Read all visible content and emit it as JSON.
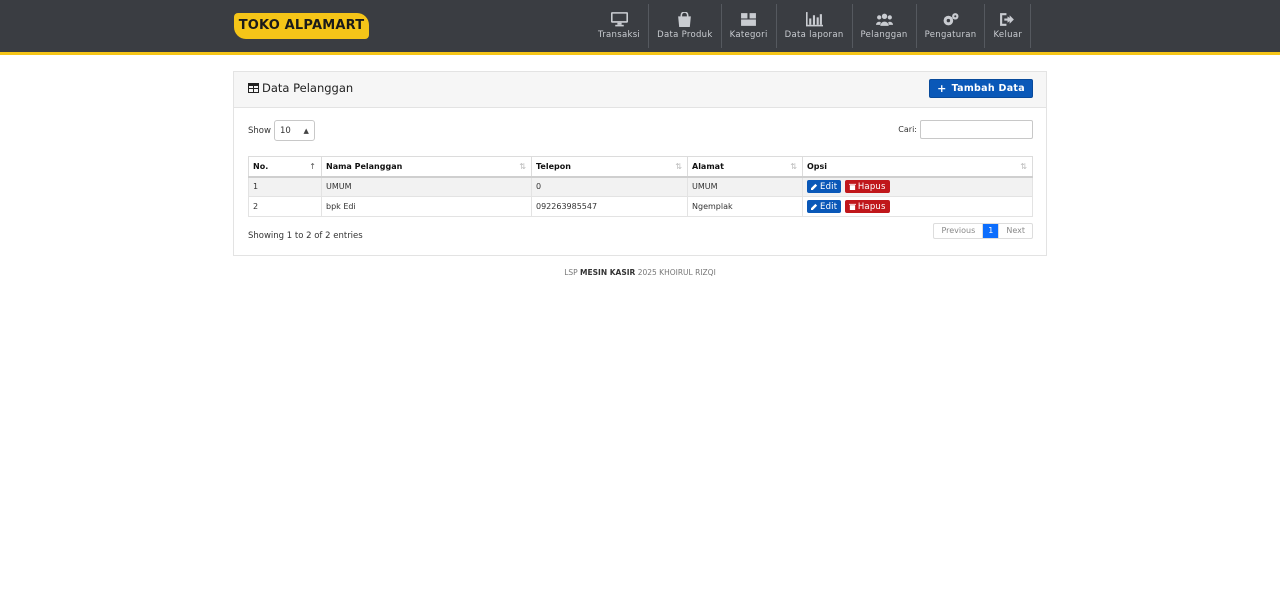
{
  "brand": "TOKO ALPAMART",
  "nav": [
    {
      "label": "Transaksi",
      "icon": "monitor-icon"
    },
    {
      "label": "Data Produk",
      "icon": "shopping-bag-icon"
    },
    {
      "label": "Kategori",
      "icon": "boxes-icon"
    },
    {
      "label": "Data laporan",
      "icon": "bar-chart-icon"
    },
    {
      "label": "Pelanggan",
      "icon": "users-icon"
    },
    {
      "label": "Pengaturan",
      "icon": "gears-icon"
    },
    {
      "label": "Keluar",
      "icon": "sign-out-icon"
    }
  ],
  "panel": {
    "title": "Data Pelanggan",
    "add_label": "Tambah Data",
    "show_label": "Show",
    "page_size": "10",
    "search_label": "Cari:",
    "search_value": "",
    "columns": [
      "No.",
      "Nama Pelanggan",
      "Telepon",
      "Alamat",
      "Opsi"
    ],
    "rows": [
      {
        "no": "1",
        "nama": "UMUM",
        "telepon": "0",
        "alamat": "UMUM"
      },
      {
        "no": "2",
        "nama": "bpk Edi",
        "telepon": "092263985547",
        "alamat": "Ngemplak"
      }
    ],
    "edit_label": "Edit",
    "delete_label": "Hapus",
    "info": "Showing 1 to 2 of 2 entries",
    "pager": {
      "prev": "Previous",
      "current": "1",
      "next": "Next"
    }
  },
  "footer": {
    "prefix": "LSP",
    "strong": "MESIN KASIR",
    "suffix": "2025 KHOIRUL RIZQI"
  },
  "colors": {
    "navbar": "#3a3d42",
    "brand": "#f5c518",
    "primary": "#0a58b8",
    "danger": "#c0171b"
  }
}
